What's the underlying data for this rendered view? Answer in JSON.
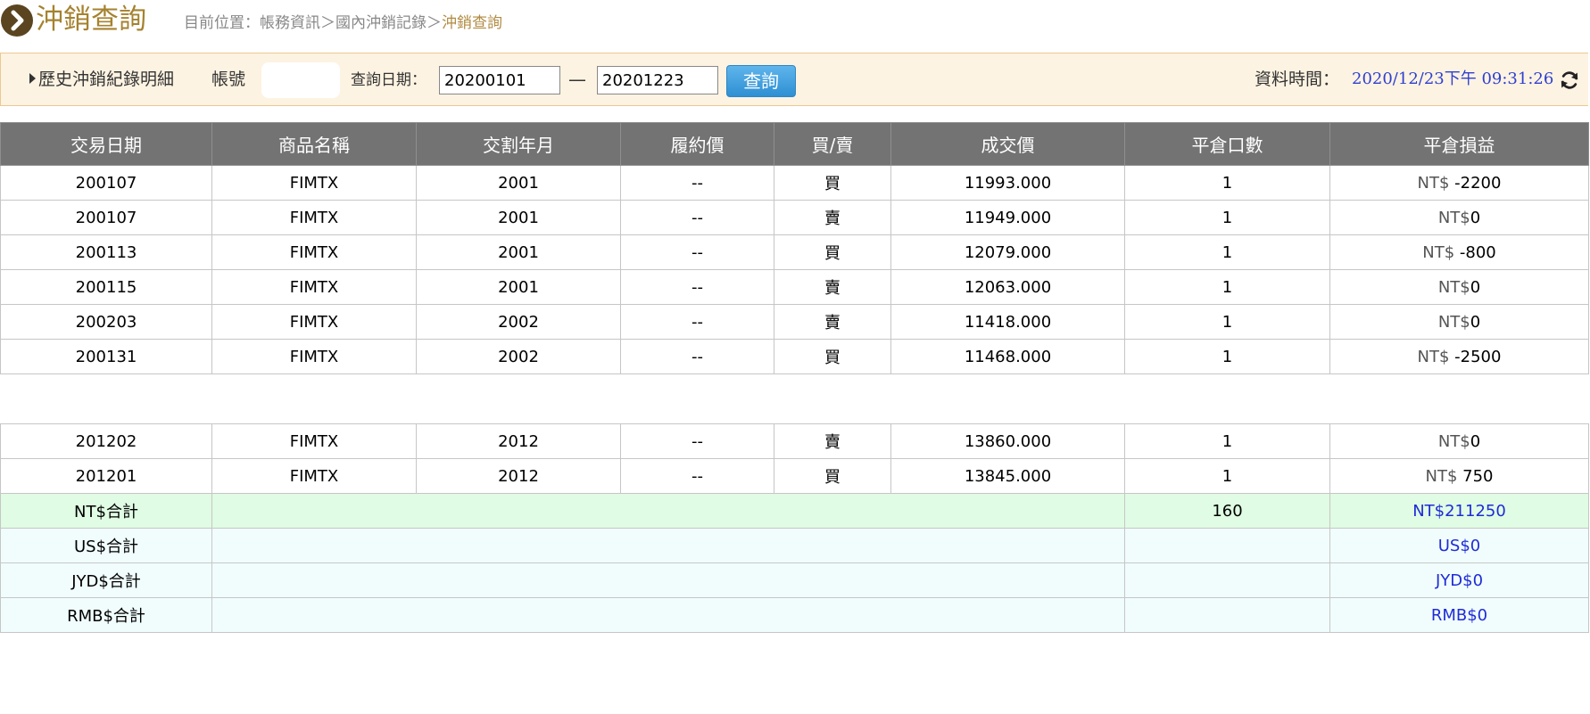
{
  "header": {
    "title": "沖銷查詢",
    "breadcrumb": {
      "prefix": "目前位置：",
      "items": [
        "帳務資訊",
        "國內沖銷記錄"
      ],
      "separator": "＞",
      "current": "沖銷查詢"
    }
  },
  "filter": {
    "section_label": "歷史沖銷紀錄明細",
    "account_label": "帳號",
    "date_label": "查詢日期：",
    "start_date": "20200101",
    "end_date": "20201223",
    "dash": "—",
    "query_button": "查詢",
    "data_time_label": "資料時間：",
    "data_time_value": "2020/12/23下午 09:31:26"
  },
  "table": {
    "columns": [
      "交易日期",
      "商品名稱",
      "交割年月",
      "履約價",
      "買/賣",
      "成交價",
      "平倉口數",
      "平倉損益"
    ],
    "rows_top": [
      {
        "date": "200107",
        "product": "FIMTX",
        "delivery": "2001",
        "strike": "--",
        "side": "買",
        "price": "11993.000",
        "qty": "1",
        "pnl_prefix": "NT$",
        "pnl": " -2200"
      },
      {
        "date": "200107",
        "product": "FIMTX",
        "delivery": "2001",
        "strike": "--",
        "side": "賣",
        "price": "11949.000",
        "qty": "1",
        "pnl_prefix": "NT$",
        "pnl": "0"
      },
      {
        "date": "200113",
        "product": "FIMTX",
        "delivery": "2001",
        "strike": "--",
        "side": "買",
        "price": "12079.000",
        "qty": "1",
        "pnl_prefix": "NT$",
        "pnl": " -800"
      },
      {
        "date": "200115",
        "product": "FIMTX",
        "delivery": "2001",
        "strike": "--",
        "side": "賣",
        "price": "12063.000",
        "qty": "1",
        "pnl_prefix": "NT$",
        "pnl": "0"
      },
      {
        "date": "200203",
        "product": "FIMTX",
        "delivery": "2002",
        "strike": "--",
        "side": "賣",
        "price": "11418.000",
        "qty": "1",
        "pnl_prefix": "NT$",
        "pnl": "0"
      },
      {
        "date": "200131",
        "product": "FIMTX",
        "delivery": "2002",
        "strike": "--",
        "side": "買",
        "price": "11468.000",
        "qty": "1",
        "pnl_prefix": "NT$",
        "pnl": " -2500"
      }
    ],
    "rows_bottom": [
      {
        "date": "201202",
        "product": "FIMTX",
        "delivery": "2012",
        "strike": "--",
        "side": "賣",
        "price": "13860.000",
        "qty": "1",
        "pnl_prefix": "NT$",
        "pnl": "0"
      },
      {
        "date": "201201",
        "product": "FIMTX",
        "delivery": "2012",
        "strike": "--",
        "side": "買",
        "price": "13845.000",
        "qty": "1",
        "pnl_prefix": "NT$",
        "pnl": " 750"
      }
    ],
    "totals": [
      {
        "label": "NT$合計",
        "qty": "160",
        "value": "NT$211250"
      },
      {
        "label": "US$合計",
        "qty": "",
        "value": "US$0"
      },
      {
        "label": "JYD$合計",
        "qty": "",
        "value": "JYD$0"
      },
      {
        "label": "RMB$合計",
        "qty": "",
        "value": "RMB$0"
      }
    ]
  },
  "colors": {
    "title": "#a5822f",
    "header_bg": "#737373",
    "filter_bg": "#fdf3e2",
    "link_blue": "#2e3fd0",
    "nt_total_bg": "#e0fce4",
    "other_total_bg": "#f1fdfd"
  },
  "icons": {
    "title_icon": "chevron-right-circle-icon",
    "refresh_icon": "refresh-icon",
    "section_icon": "caret-right-icon"
  }
}
